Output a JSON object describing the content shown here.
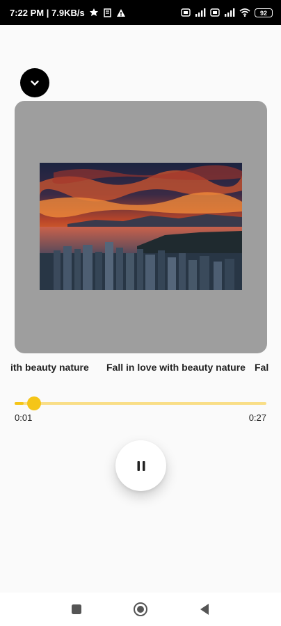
{
  "status_bar": {
    "time_speed": "7:22 PM | 7.9KB/s",
    "battery": "92"
  },
  "player": {
    "title": "Fall in love with beauty nature",
    "title_left_fragment": "ith beauty nature",
    "title_right_fragment": "Fal",
    "elapsed": "0:01",
    "total": "0:27",
    "progress_fraction": 0.037,
    "accent_color": "#f5c518",
    "track_color": "#f9de87",
    "artwork_bg": "#9e9e9e"
  },
  "icons": {
    "collapse": "chevron-down-icon",
    "play_state": "pause-icon",
    "nav": [
      "recents-square-icon",
      "home-circle-icon",
      "back-triangle-icon"
    ]
  }
}
